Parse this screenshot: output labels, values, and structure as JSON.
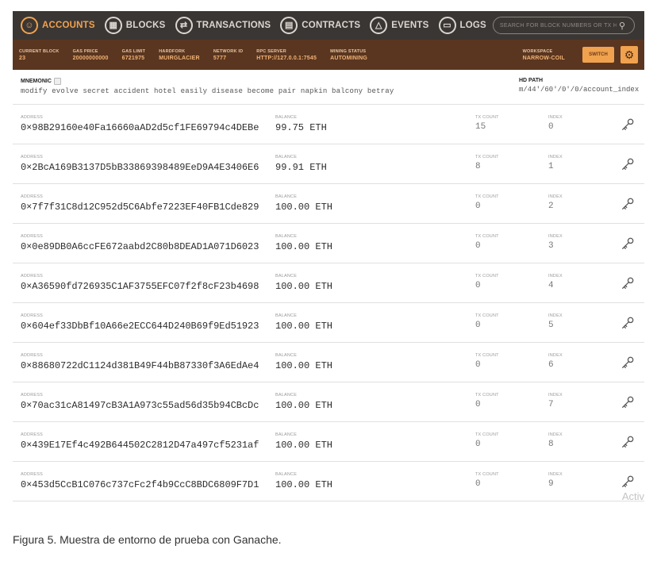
{
  "nav": {
    "items": [
      {
        "label": "ACCOUNTS",
        "icon": "accounts-icon",
        "glyph": "☺",
        "active": true
      },
      {
        "label": "BLOCKS",
        "icon": "blocks-icon",
        "glyph": "▦",
        "active": false
      },
      {
        "label": "TRANSACTIONS",
        "icon": "transactions-icon",
        "glyph": "⇄",
        "active": false
      },
      {
        "label": "CONTRACTS",
        "icon": "contracts-icon",
        "glyph": "▤",
        "active": false
      },
      {
        "label": "EVENTS",
        "icon": "events-icon",
        "glyph": "△",
        "active": false
      },
      {
        "label": "LOGS",
        "icon": "logs-icon",
        "glyph": "▭",
        "active": false
      }
    ],
    "search_placeholder": "SEARCH FOR BLOCK NUMBERS OR TX HASHES"
  },
  "status": {
    "current_block": {
      "label": "CURRENT BLOCK",
      "value": "23"
    },
    "gas_price": {
      "label": "GAS PRICE",
      "value": "20000000000"
    },
    "gas_limit": {
      "label": "GAS LIMIT",
      "value": "6721975"
    },
    "hardfork": {
      "label": "HARDFORK",
      "value": "MUIRGLACIER"
    },
    "network_id": {
      "label": "NETWORK ID",
      "value": "5777"
    },
    "rpc_server": {
      "label": "RPC SERVER",
      "value": "HTTP://127.0.0.1:7545"
    },
    "mining_status": {
      "label": "MINING STATUS",
      "value": "AUTOMINING"
    },
    "workspace": {
      "label": "WORKSPACE",
      "value": "NARROW-COIL"
    },
    "switch_label": "SWITCH"
  },
  "mnemonic": {
    "label": "MNEMONIC",
    "words": "modify evolve secret accident hotel easily disease become pair napkin balcony betray",
    "hd_path_label": "HD PATH",
    "hd_path": "m/44'/60'/0'/0/account_index"
  },
  "columns": {
    "address": "ADDRESS",
    "balance": "BALANCE",
    "tx_count": "TX COUNT",
    "index": "INDEX"
  },
  "accounts": [
    {
      "address": "0×98B29160e40Fa16660aAD2d5cf1FE69794c4DEBe",
      "balance": "99.75 ETH",
      "tx_count": "15",
      "index": "0"
    },
    {
      "address": "0×2BcA169B3137D5bB33869398489EeD9A4E3406E6",
      "balance": "99.91 ETH",
      "tx_count": "8",
      "index": "1"
    },
    {
      "address": "0×7f7f31C8d12C952d5C6Abfe7223EF40FB1Cde829",
      "balance": "100.00 ETH",
      "tx_count": "0",
      "index": "2"
    },
    {
      "address": "0×0e89DB0A6ccFE672aabd2C80b8DEAD1A071D6023",
      "balance": "100.00 ETH",
      "tx_count": "0",
      "index": "3"
    },
    {
      "address": "0×A36590fd726935C1AF3755EFC07f2f8cF23b4698",
      "balance": "100.00 ETH",
      "tx_count": "0",
      "index": "4"
    },
    {
      "address": "0×604ef33DbBf10A66e2ECC644D240B69f9Ed51923",
      "balance": "100.00 ETH",
      "tx_count": "0",
      "index": "5"
    },
    {
      "address": "0×88680722dC1124d381B49F44bB87330f3A6EdAe4",
      "balance": "100.00 ETH",
      "tx_count": "0",
      "index": "6"
    },
    {
      "address": "0×70ac31cA81497cB3A1A973c55ad56d35b94CBcDc",
      "balance": "100.00 ETH",
      "tx_count": "0",
      "index": "7"
    },
    {
      "address": "0×439E17Ef4c492B644502C2812D47a497cf5231af",
      "balance": "100.00 ETH",
      "tx_count": "0",
      "index": "8"
    },
    {
      "address": "0×453d5CcB1C076c737cFc2f4b9CcC8BDC6809F7D1",
      "balance": "100.00 ETH",
      "tx_count": "0",
      "index": "9"
    }
  ],
  "watermark": "Activ",
  "caption": "Figura 5. Muestra de entorno de prueba con Ganache.",
  "colors": {
    "nav_bg": "#3a3634",
    "status_bg": "#5a3620",
    "accent": "#f1a24e"
  }
}
